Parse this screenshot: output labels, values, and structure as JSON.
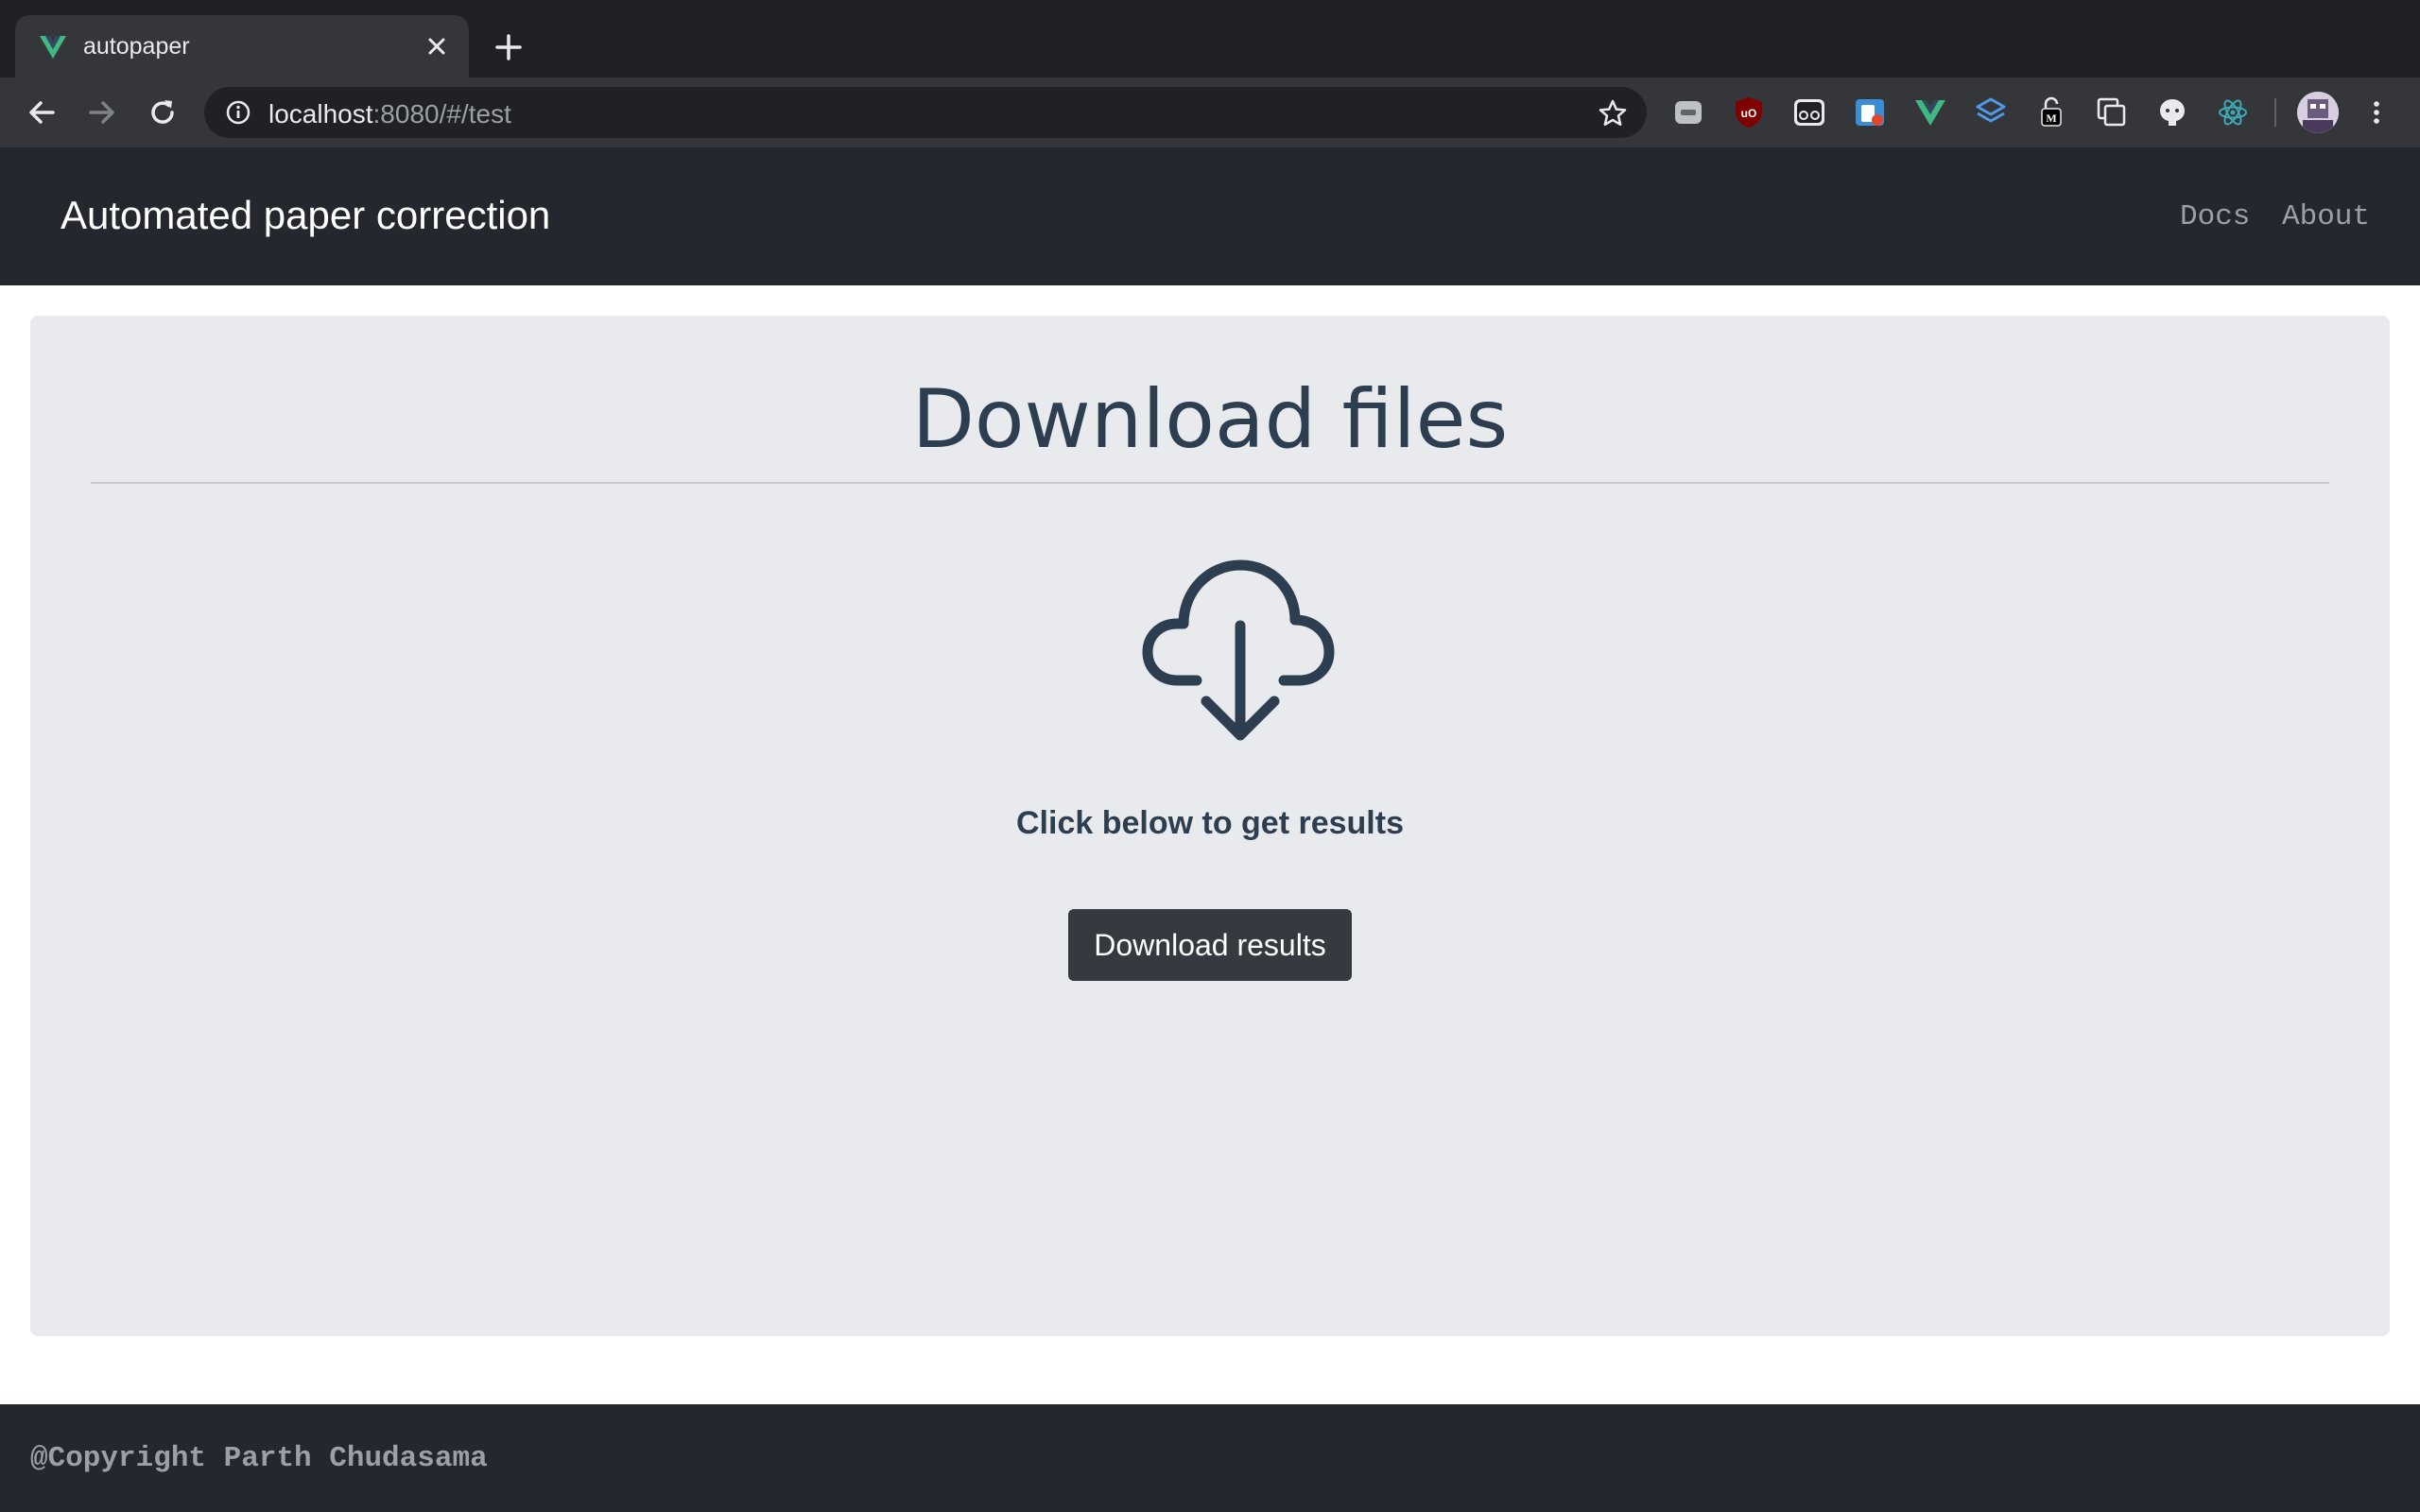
{
  "browser": {
    "tab": {
      "title": "autopaper",
      "favicon": "vue-logo-icon"
    },
    "address": {
      "host": "localhost",
      "rest": ":8080/#/test"
    },
    "extensions": [
      "gray-extension-icon",
      "ublock-icon",
      "reader-glasses-icon",
      "tab-extension-icon",
      "vue-devtools-icon",
      "layers-icon",
      "medium-lock-icon",
      "copy-icon",
      "github-octocat-icon",
      "atom-icon"
    ]
  },
  "navbar": {
    "brand": "Automated paper correction",
    "links": [
      "Docs",
      "About"
    ]
  },
  "main": {
    "title": "Download files",
    "icon": "cloud-download-icon",
    "hint": "Click below to get results",
    "button_label": "Download results"
  },
  "footer": {
    "text": "@Copyright Parth Chudasama"
  },
  "colors": {
    "accent": "#2c3e50",
    "navbar": "#24272d",
    "card": "#e9eaee",
    "button": "#343a40"
  }
}
